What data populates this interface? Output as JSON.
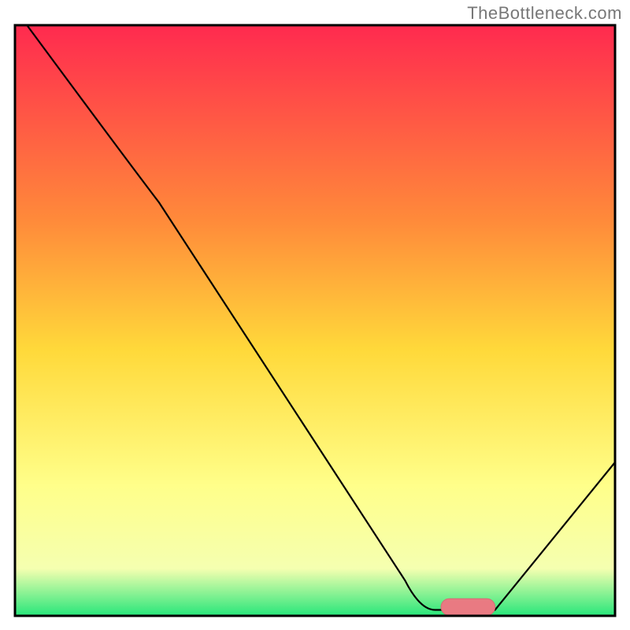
{
  "watermark": "TheBottleneck.com",
  "chart_data": {
    "type": "line",
    "title": "",
    "xlabel": "",
    "ylabel": "",
    "x_range": [
      0,
      100
    ],
    "y_range": [
      0,
      100
    ],
    "gradient_stops": [
      {
        "offset": 0,
        "color": "#ff2a4f"
      },
      {
        "offset": 33,
        "color": "#ff8a3a"
      },
      {
        "offset": 55,
        "color": "#ffd93a"
      },
      {
        "offset": 78,
        "color": "#ffff8a"
      },
      {
        "offset": 92,
        "color": "#f5ffb0"
      },
      {
        "offset": 100,
        "color": "#27e67a"
      }
    ],
    "curve_points": [
      {
        "x": 2,
        "y": 100
      },
      {
        "x": 18,
        "y": 78
      },
      {
        "x": 24,
        "y": 70
      },
      {
        "x": 65,
        "y": 6
      },
      {
        "x": 70,
        "y": 1
      },
      {
        "x": 80,
        "y": 1
      },
      {
        "x": 100,
        "y": 26
      }
    ],
    "marker": {
      "x_start": 71,
      "x_end": 80,
      "y": 1.5,
      "radius": 1.4,
      "fill": "#e97a82",
      "stroke": "#d86b74"
    },
    "frame_stroke": "#000000",
    "frame_width": 3,
    "curve_stroke": "#000000",
    "curve_width": 2.2
  }
}
